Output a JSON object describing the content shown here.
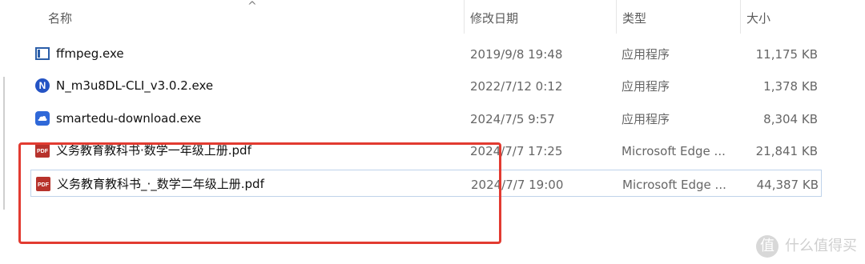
{
  "header": {
    "sort_arrow": "^",
    "name": "名称",
    "modified": "修改日期",
    "type": "类型",
    "size": "大小"
  },
  "files": [
    {
      "name": "ffmpeg.exe",
      "modified": "2019/9/8 19:48",
      "type": "应用程序",
      "size": "11,175 KB",
      "icon": "ffmpeg-app-icon",
      "selected": false
    },
    {
      "name": "N_m3u8DL-CLI_v3.0.2.exe",
      "modified": "2022/7/12 0:12",
      "type": "应用程序",
      "size": "1,378 KB",
      "icon": "n-app-icon",
      "selected": false
    },
    {
      "name": "smartedu-download.exe",
      "modified": "2024/7/5 9:57",
      "type": "应用程序",
      "size": "8,304 KB",
      "icon": "cloud-download-app-icon",
      "selected": false
    },
    {
      "name": "义务教育教科书·数学一年级上册.pdf",
      "modified": "2024/7/7 17:25",
      "type": "Microsoft Edge ...",
      "size": "21,841 KB",
      "icon": "pdf-file-icon",
      "selected": false
    },
    {
      "name": "义务教育教科书_·_数学二年级上册.pdf",
      "modified": "2024/7/7 19:00",
      "type": "Microsoft Edge ...",
      "size": "44,387 KB",
      "icon": "pdf-file-icon",
      "selected": true
    }
  ],
  "watermark": {
    "logo_text": "值",
    "text": "什么值得买"
  },
  "colors": {
    "highlight_box": "#e23b31",
    "selected_row_border": "#bfd3ea"
  }
}
